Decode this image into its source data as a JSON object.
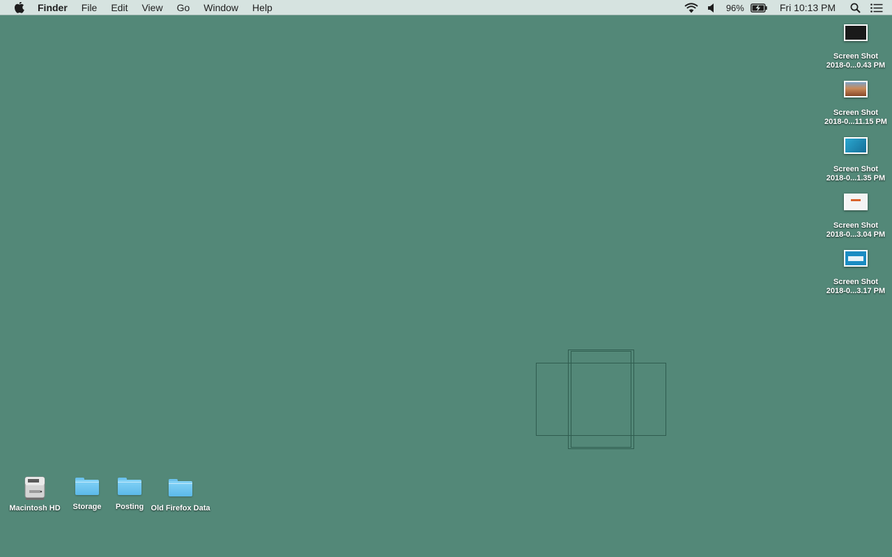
{
  "menubar": {
    "app_name": "Finder",
    "menus": [
      "File",
      "Edit",
      "View",
      "Go",
      "Window",
      "Help"
    ],
    "battery_percent": "96%",
    "clock": "Fri 10:13 PM",
    "icons": {
      "apple": "apple-icon",
      "wifi": "wifi-icon",
      "volume": "volume-icon",
      "battery": "battery-charging-icon",
      "spotlight": "search-icon",
      "notifications": "notification-center-icon"
    }
  },
  "desktop": {
    "background_color": "#538878",
    "screenshots": [
      {
        "line1": "Screen Shot",
        "line2": "2018-0...0.43 PM",
        "thumb_color": "#1a1a1a"
      },
      {
        "line1": "Screen Shot",
        "line2": "2018-0...11.15 PM",
        "thumb_color": "#b86a3a"
      },
      {
        "line1": "Screen Shot",
        "line2": "2018-0...1.35 PM",
        "thumb_color": "#1e8fb8"
      },
      {
        "line1": "Screen Shot",
        "line2": "2018-0...3.04 PM",
        "thumb_color": "#f4f4f4"
      },
      {
        "line1": "Screen Shot",
        "line2": "2018-0...3.17 PM",
        "thumb_color": "#1b8cc2"
      }
    ],
    "items": [
      {
        "label": "Macintosh HD",
        "icon": "hard-drive-icon"
      },
      {
        "label": "Storage",
        "icon": "folder-icon"
      },
      {
        "label": "Posting",
        "icon": "folder-icon"
      },
      {
        "label": "Old Firefox Data",
        "icon": "folder-icon"
      }
    ]
  }
}
